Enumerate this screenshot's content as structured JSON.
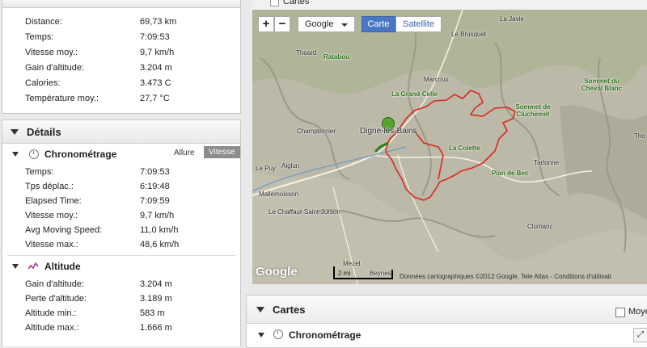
{
  "recap": {
    "rows": [
      {
        "label": "Distance:",
        "value": "69,73 km"
      },
      {
        "label": "Temps:",
        "value": "7:09:53"
      },
      {
        "label": "Vitesse moy.:",
        "value": "9,7 km/h"
      },
      {
        "label": "Gain d'altitude:",
        "value": "3.204 m"
      },
      {
        "label": "Calories:",
        "value": "3.473 C"
      },
      {
        "label": "Température moy.:",
        "value": "27,7 °C"
      }
    ]
  },
  "details": {
    "title": "Détails",
    "chrono": {
      "title": "Chronométrage",
      "tab_allure": "Allure",
      "tab_vitesse": "Vitesse",
      "rows": [
        {
          "label": "Temps:",
          "value": "7:09:53"
        },
        {
          "label": "Tps déplac.:",
          "value": "6:19:48"
        },
        {
          "label": "Elapsed Time:",
          "value": "7:09:59"
        },
        {
          "label": "Vitesse moy.:",
          "value": "9,7 km/h"
        },
        {
          "label": "Avg Moving Speed:",
          "value": "11,0 km/h"
        },
        {
          "label": "Vitesse max.:",
          "value": "48,6 km/h"
        }
      ]
    },
    "altitude": {
      "title": "Altitude",
      "rows": [
        {
          "label": "Gain d'altitude:",
          "value": "3.204 m"
        },
        {
          "label": "Perte d'altitude:",
          "value": "3.189 m"
        },
        {
          "label": "Altitude min.:",
          "value": "583 m"
        },
        {
          "label": "Altitude max.:",
          "value": "1.666 m"
        }
      ]
    }
  },
  "map": {
    "top_title": "Cartes",
    "zoom_in": "+",
    "zoom_out": "−",
    "provider": "Google",
    "type_carte": "Carte",
    "type_satellite": "Satellite",
    "places": {
      "javie": "La Javie",
      "brusquet": "Le Brusquet",
      "thoard": "Thoard",
      "ratabou": "Ratabou",
      "marcoux": "Marcoux",
      "grandcelle": "La Grand-Celle",
      "sommetcheval": "Sommet du Cheval Blanc",
      "sommetcluch": "Sommet de Cluchemet",
      "champtercier": "Champtercier",
      "digne": "Digne-les-Bains",
      "colette": "La Colette",
      "lepuy": "Le Puy",
      "aiglun": "Aiglun",
      "tartonne": "Tartonne",
      "planbec": "Plan de Bec",
      "mallemoisson": "Mallemoisson",
      "chaffaut": "Le Chaffaut-Saint-Jurson",
      "clumanc": "Clumanc",
      "mezel": "Mezel",
      "beynes": "Beynes",
      "tho": "Tho"
    },
    "scale_label": "2 mi",
    "google_logo": "Google",
    "attribution": "Données cartographiques ©2012 Google, Tele Atlas - Conditions d'utilisati"
  },
  "cartes_panel": {
    "title": "Cartes",
    "checkbox_label": "Moyer",
    "chrono_title": "Chronométrage",
    "expand": "⤢"
  }
}
